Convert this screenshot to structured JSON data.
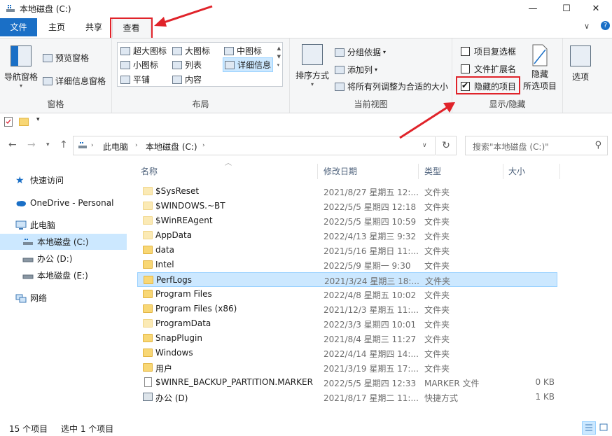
{
  "window": {
    "title": "本地磁盘 (C:)",
    "minimize": "—",
    "maximize": "☐",
    "close": "✕"
  },
  "tabs": [
    {
      "label": "文件"
    },
    {
      "label": "主页"
    },
    {
      "label": "共享"
    },
    {
      "label": "查看"
    }
  ],
  "tabs_right": {
    "collapse": "∨",
    "help": "?"
  },
  "ribbon": {
    "panes": {
      "label": "窗格",
      "nav_pane": "导航窗格",
      "preview_pane": "预览窗格",
      "details_pane": "详细信息窗格"
    },
    "layout": {
      "label": "布局",
      "items": [
        "超大图标",
        "大图标",
        "中图标",
        "小图标",
        "列表",
        "详细信息",
        "平铺",
        "内容"
      ]
    },
    "current_view": {
      "label": "当前视图",
      "sort_by": "排序方式",
      "group_by": "分组依据",
      "add_columns": "添加列",
      "fit_columns": "将所有列调整为合适的大小"
    },
    "show_hide": {
      "label": "显示/隐藏",
      "item_checkboxes": "项目复选框",
      "file_extensions": "文件扩展名",
      "hidden_items": "隐藏的项目",
      "hide_selected_1": "隐藏",
      "hide_selected_2": "所选项目"
    },
    "options": "选项"
  },
  "address": {
    "crumbs": [
      "此电脑",
      "本地磁盘 (C:)"
    ],
    "search_placeholder": "搜索\"本地磁盘 (C:)\""
  },
  "sidebar": {
    "items": [
      {
        "label": "快速访问"
      },
      {
        "label": "OneDrive - Personal"
      },
      {
        "label": "此电脑"
      },
      {
        "label": "本地磁盘 (C:)"
      },
      {
        "label": "办公 (D:)"
      },
      {
        "label": "本地磁盘 (E:)"
      },
      {
        "label": "网络"
      }
    ]
  },
  "columns": {
    "name": "名称",
    "date": "修改日期",
    "type": "类型",
    "size": "大小"
  },
  "files": [
    {
      "name": "$SysReset",
      "date": "2021/8/27 星期五 12:...",
      "type": "文件夹",
      "size": ""
    },
    {
      "name": "$WINDOWS.~BT",
      "date": "2022/5/5 星期四 12:18",
      "type": "文件夹",
      "size": ""
    },
    {
      "name": "$WinREAgent",
      "date": "2022/5/5 星期四 10:59",
      "type": "文件夹",
      "size": ""
    },
    {
      "name": "AppData",
      "date": "2022/4/13 星期三 9:32",
      "type": "文件夹",
      "size": ""
    },
    {
      "name": "data",
      "date": "2021/5/16 星期日 11:...",
      "type": "文件夹",
      "size": ""
    },
    {
      "name": "Intel",
      "date": "2022/5/9 星期一 9:30",
      "type": "文件夹",
      "size": ""
    },
    {
      "name": "PerfLogs",
      "date": "2021/3/24 星期三 18:...",
      "type": "文件夹",
      "size": ""
    },
    {
      "name": "Program Files",
      "date": "2022/4/8 星期五 10:02",
      "type": "文件夹",
      "size": ""
    },
    {
      "name": "Program Files (x86)",
      "date": "2021/12/3 星期五 11:...",
      "type": "文件夹",
      "size": ""
    },
    {
      "name": "ProgramData",
      "date": "2022/3/3 星期四 10:01",
      "type": "文件夹",
      "size": ""
    },
    {
      "name": "SnapPlugin",
      "date": "2021/8/4 星期三 11:27",
      "type": "文件夹",
      "size": ""
    },
    {
      "name": "Windows",
      "date": "2022/4/14 星期四 14:...",
      "type": "文件夹",
      "size": ""
    },
    {
      "name": "用户",
      "date": "2021/3/19 星期五 17:...",
      "type": "文件夹",
      "size": ""
    },
    {
      "name": "$WINRE_BACKUP_PARTITION.MARKER",
      "date": "2022/5/5 星期四 12:33",
      "type": "MARKER 文件",
      "size": "0 KB"
    },
    {
      "name": "办公 (D)",
      "date": "2021/8/17 星期二 11:...",
      "type": "快捷方式",
      "size": "1 KB"
    }
  ],
  "status": {
    "count": "15 个项目",
    "selected": "选中 1 个项目"
  },
  "colors": {
    "accent": "#1a6fc6",
    "selection": "#cce8ff",
    "annotation": "#e0232a"
  }
}
